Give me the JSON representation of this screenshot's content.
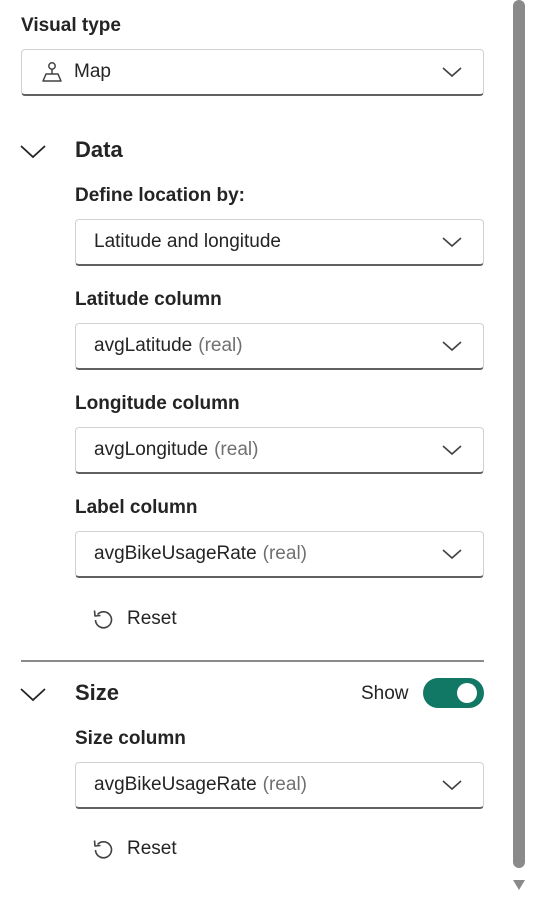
{
  "visual_type": {
    "label": "Visual type",
    "value": "Map",
    "icon": "map-pin-icon"
  },
  "data_section": {
    "title": "Data",
    "define_location": {
      "label": "Define location by:",
      "value": "Latitude and longitude"
    },
    "latitude": {
      "label": "Latitude column",
      "value": "avgLatitude",
      "type": "(real)"
    },
    "longitude": {
      "label": "Longitude column",
      "value": "avgLongitude",
      "type": "(real)"
    },
    "label_col": {
      "label": "Label column",
      "value": "avgBikeUsageRate",
      "type": "(real)"
    },
    "reset_label": "Reset"
  },
  "size_section": {
    "title": "Size",
    "toggle_label": "Show",
    "toggle_on": true,
    "size_col": {
      "label": "Size column",
      "value": "avgBikeUsageRate",
      "type": "(real)"
    },
    "reset_label": "Reset"
  },
  "colors": {
    "toggle_on": "#117865",
    "scrollbar": "#8a8a8a"
  }
}
